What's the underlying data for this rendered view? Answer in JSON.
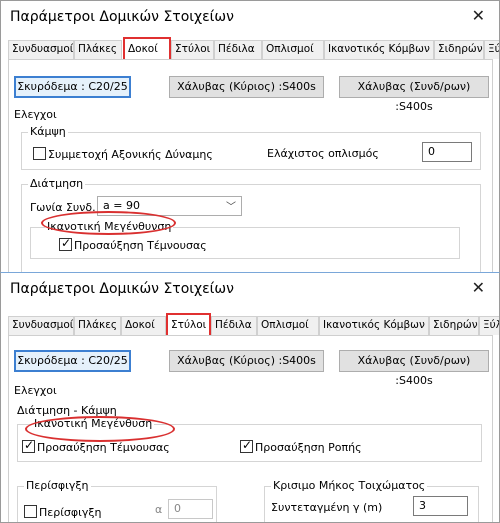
{
  "dialog1": {
    "title": "Παράμετροι Δομικών Στοιχείων",
    "close_glyph": "✕",
    "tabs": [
      "Συνδυασμοί",
      "Πλάκες",
      "Δοκοί",
      "Στύλοι",
      "Πέδιλα",
      "Οπλισμοί",
      "Ικανοτικός Κόμβων",
      "Σιδηρών",
      "Ξύλινα"
    ],
    "active_tab": "Δοκοί",
    "buttons": {
      "concrete": "Σκυρόδεμα : C20/25",
      "steel_main": "Χάλυβας (Κύριος) :S400s",
      "steel_link": "Χάλυβας (Συνδ/ρων) :S400s"
    },
    "checks_group": "Ελεγχοι",
    "bending_group": "Κάμψη",
    "axial_check": "Συμμετοχή Αξονικής Δύναμης",
    "min_reinf_label": "Ελάχιστος οπλισμός",
    "min_reinf_value": "0",
    "shear_group": "Διάτμηση",
    "angle_label": "Γωνία Συνδ.",
    "angle_value": "a = 90",
    "capacity_group": "Ικανοτική Μεγένθυνση",
    "shear_increase": "Προσαύξηση Τέμνουσας"
  },
  "dialog2": {
    "title": "Παράμετροι Δομικών Στοιχείων",
    "close_glyph": "✕",
    "tabs": [
      "Συνδυασμοί",
      "Πλάκες",
      "Δοκοί",
      "Στύλοι",
      "Πέδιλα",
      "Οπλισμοί",
      "Ικανοτικός Κόμβων",
      "Σιδηρών",
      "Ξύλινα"
    ],
    "active_tab": "Στύλοι",
    "buttons": {
      "concrete": "Σκυρόδεμα : C20/25",
      "steel_main": "Χάλυβας (Κύριος) :S400s",
      "steel_link": "Χάλυβας (Συνδ/ρων) :S400s"
    },
    "checks_group": "Ελεγχοι",
    "shear_bending_group": "Διάτμηση - Κάμψη",
    "capacity_group": "Ικανοτική Μεγένθυση",
    "shear_increase": "Προσαύξηση Τέμνουσας",
    "moment_increase": "Προσαύξηση Ροπής",
    "confinement_group": "Περίσφιγξη",
    "confinement_check": "Περίσφιγξη",
    "alpha_label": "α",
    "alpha_value": "0",
    "critical_group": "Κρισιμο Μήκος Τοιχώματος",
    "coord_label": "Συντεταγμένη γ (m)",
    "coord_value": "3"
  },
  "colors": {
    "highlight": "#e03030",
    "default_button": "#3c7fd1"
  }
}
